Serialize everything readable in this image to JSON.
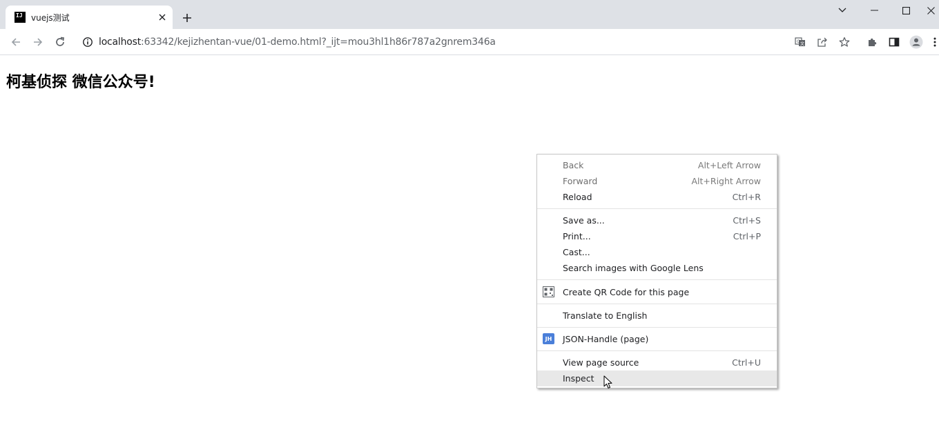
{
  "tab": {
    "favicon_text": "IJ",
    "title": "vuejs测试"
  },
  "toolbar": {
    "url_host": "localhost",
    "url_rest": ":63342/kejizhentan-vue/01-demo.html?_ijt=mou3hl1h86r787a2gnrem346a"
  },
  "page": {
    "heading": "柯基侦探 微信公众号!"
  },
  "context_menu": {
    "items": [
      {
        "label": "Back",
        "shortcut": "Alt+Left Arrow"
      },
      {
        "label": "Forward",
        "shortcut": "Alt+Right Arrow"
      },
      {
        "label": "Reload",
        "shortcut": "Ctrl+R"
      },
      {
        "label": "Save as...",
        "shortcut": "Ctrl+S"
      },
      {
        "label": "Print...",
        "shortcut": "Ctrl+P"
      },
      {
        "label": "Cast...",
        "shortcut": ""
      },
      {
        "label": "Search images with Google Lens",
        "shortcut": ""
      },
      {
        "label": "Create QR Code for this page",
        "shortcut": ""
      },
      {
        "label": "Translate to English",
        "shortcut": ""
      },
      {
        "label": "JSON-Handle (page)",
        "shortcut": ""
      },
      {
        "label": "View page source",
        "shortcut": "Ctrl+U"
      },
      {
        "label": "Inspect",
        "shortcut": ""
      }
    ],
    "jh_icon_text": "JH"
  },
  "colors": {
    "tabstrip": "#dee1e6",
    "hover": "#e8e8e8",
    "jh_icon": "#4a7fd9"
  }
}
